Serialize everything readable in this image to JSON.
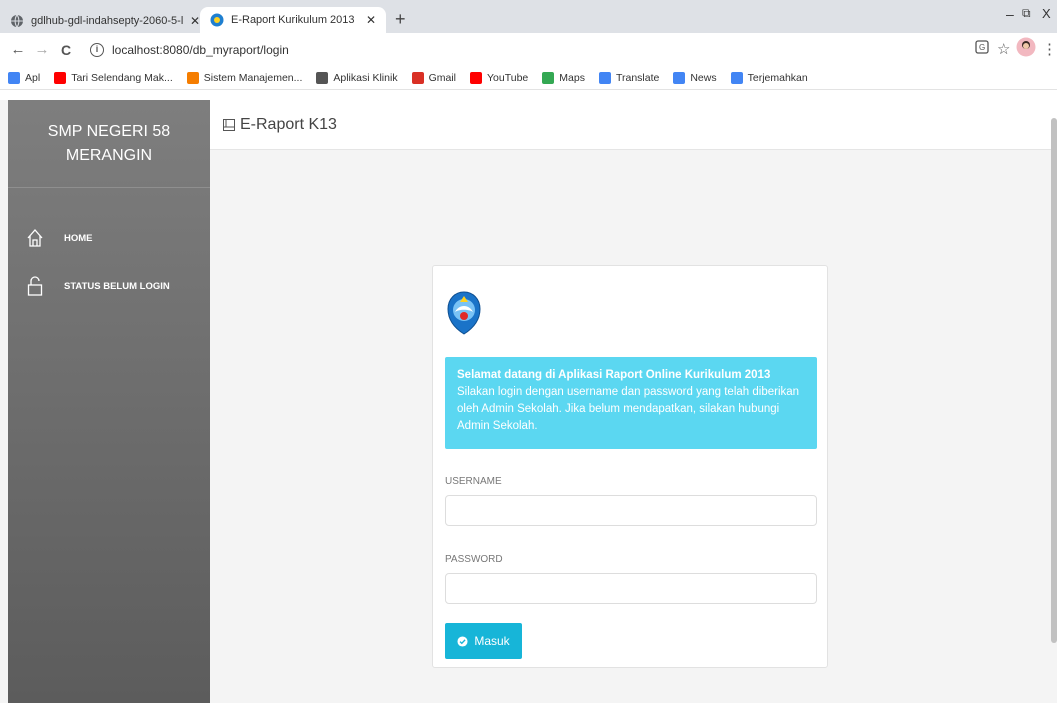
{
  "browser": {
    "tabs": [
      {
        "title": "gdlhub-gdl-indahsepty-2060-5-l"
      },
      {
        "title": "E-Raport Kurikulum 2013"
      }
    ],
    "new_tab": "+",
    "minimize": "–",
    "restore": "⧉",
    "close": "X",
    "url": "localhost:8080/db_myraport/login",
    "bookmarks": [
      {
        "label": "Apl",
        "icon": "apps-icon",
        "color": "#4285f4"
      },
      {
        "label": "Tari Selendang Mak...",
        "icon": "youtube-icon",
        "color": "#ff0000"
      },
      {
        "label": "Sistem Manajemen...",
        "icon": "blogger-icon",
        "color": "#f57d00"
      },
      {
        "label": "Aplikasi Klinik",
        "icon": "globe-icon",
        "color": "#555555"
      },
      {
        "label": "Gmail",
        "icon": "gmail-icon",
        "color": "#d93025"
      },
      {
        "label": "YouTube",
        "icon": "youtube-icon",
        "color": "#ff0000"
      },
      {
        "label": "Maps",
        "icon": "maps-icon",
        "color": "#34a853"
      },
      {
        "label": "Translate",
        "icon": "translate-icon",
        "color": "#4285f4"
      },
      {
        "label": "News",
        "icon": "news-icon",
        "color": "#4285f4"
      },
      {
        "label": "Terjemahkan",
        "icon": "translate-icon",
        "color": "#4285f4"
      }
    ]
  },
  "sidebar": {
    "brand_line1": "SMP NEGERI 58",
    "brand_line2": "MERANGIN",
    "items": [
      {
        "label": "HOME",
        "icon": "home-icon"
      },
      {
        "label": "STATUS BELUM LOGIN",
        "icon": "unlock-icon"
      }
    ]
  },
  "header": {
    "title": "E-Raport K13"
  },
  "login": {
    "welcome_title": "Selamat datang di Aplikasi Raport Online Kurikulum 2013",
    "welcome_text": "Silakan login dengan username dan password yang telah diberikan oleh Admin Sekolah. Jika belum mendapatkan, silakan hubungi Admin Sekolah.",
    "username_label": "USERNAME",
    "username_value": "",
    "password_label": "PASSWORD",
    "password_value": "",
    "submit_label": "Masuk"
  },
  "colors": {
    "sidebar": "#6e6e6e",
    "alert": "#5bd7f1",
    "button": "#17b5d8"
  }
}
